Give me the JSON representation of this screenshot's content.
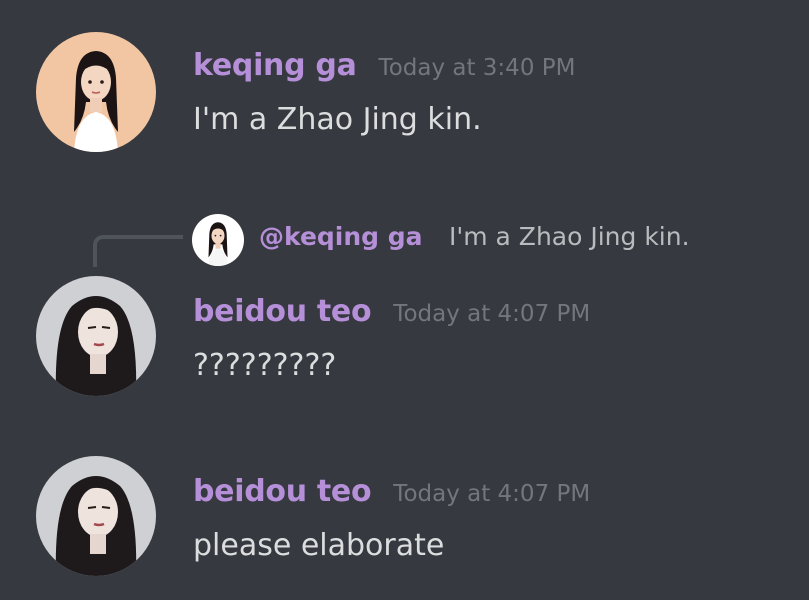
{
  "colors": {
    "background": "#36393f",
    "username": "#b68fd9",
    "timestamp": "#72767d",
    "message_text": "#dcddde",
    "reply_text": "#b9bbbe",
    "reply_line": "#4f545c"
  },
  "messages": [
    {
      "username": "keqing ga",
      "timestamp": "Today at 3:40 PM",
      "content": "I'm a Zhao Jing kin.",
      "avatar": "girl-portrait-avatar"
    },
    {
      "reply": {
        "mention": "@keqing ga",
        "text": "I'm a Zhao Jing kin.",
        "avatar": "girl-portrait-avatar"
      },
      "username": "beidou teo",
      "timestamp": "Today at 4:07 PM",
      "content": "?????????",
      "avatar": "longhair-man-avatar"
    },
    {
      "username": "beidou teo",
      "timestamp": "Today at 4:07 PM",
      "content": "please elaborate",
      "avatar": "longhair-man-avatar"
    }
  ]
}
